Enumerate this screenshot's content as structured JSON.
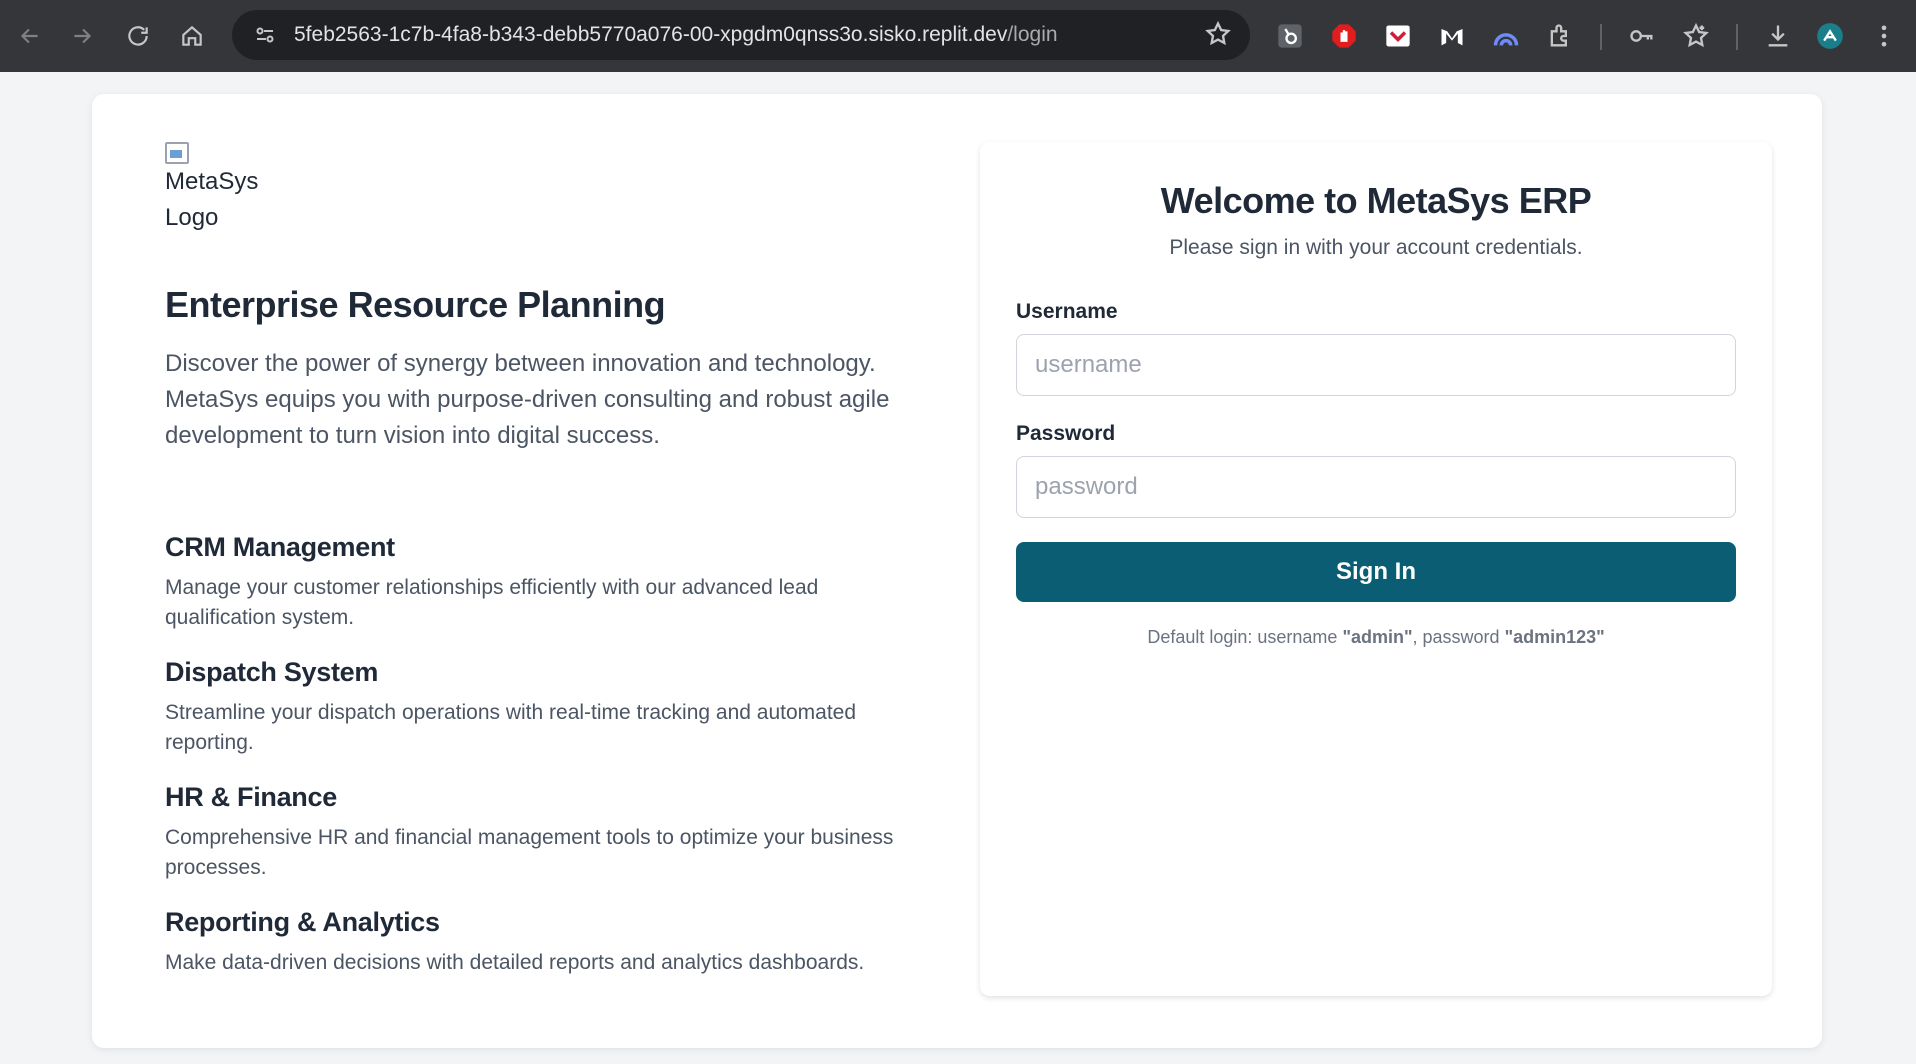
{
  "browser": {
    "url_host": "5feb2563-1c7b-4fa8-b343-debb5770a076-00-xpgdm0qnss3o.sisko.replit.dev",
    "url_path": "/login",
    "profile_initial": "A"
  },
  "brand": {
    "logo_alt": "MetaSys Logo",
    "primary_color": "#0b5d73"
  },
  "hero": {
    "title": "Enterprise Resource Planning",
    "description": "Discover the power of synergy between innovation and technology. MetaSys equips you with purpose-driven consulting and robust agile development to turn vision into digital success."
  },
  "features": [
    {
      "title": "CRM Management",
      "description": "Manage your customer relationships efficiently with our advanced lead qualification system."
    },
    {
      "title": "Dispatch System",
      "description": "Streamline your dispatch operations with real-time tracking and automated reporting."
    },
    {
      "title": "HR & Finance",
      "description": "Comprehensive HR and financial management tools to optimize your business processes."
    },
    {
      "title": "Reporting & Analytics",
      "description": "Make data-driven decisions with detailed reports and analytics dashboards."
    }
  ],
  "login": {
    "title": "Welcome to MetaSys ERP",
    "subtitle": "Please sign in with your account credentials.",
    "username_label": "Username",
    "username_placeholder": "username",
    "username_value": "",
    "password_label": "Password",
    "password_placeholder": "password",
    "password_value": "",
    "submit_label": "Sign In",
    "hint_prefix": "Default login: username ",
    "hint_user": "\"admin\"",
    "hint_mid": ", password ",
    "hint_pass": "\"admin123\""
  }
}
